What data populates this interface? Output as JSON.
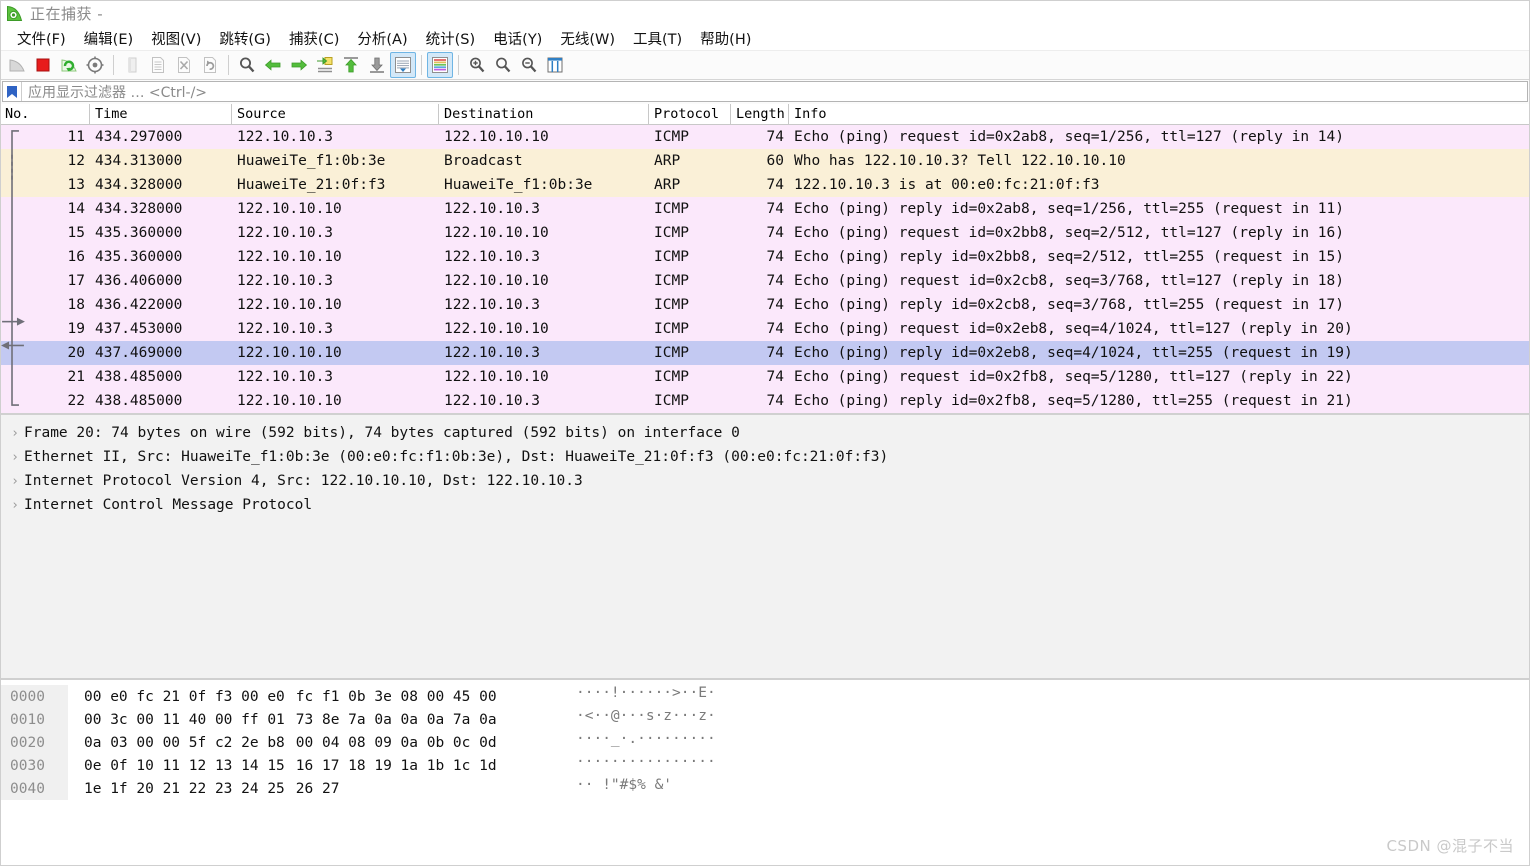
{
  "window": {
    "title": "正在捕获 -",
    "icon": "wireshark-fin-icon"
  },
  "menu": {
    "items": [
      {
        "label": "文件(F)",
        "name": "menu-file"
      },
      {
        "label": "编辑(E)",
        "name": "menu-edit"
      },
      {
        "label": "视图(V)",
        "name": "menu-view"
      },
      {
        "label": "跳转(G)",
        "name": "menu-go"
      },
      {
        "label": "捕获(C)",
        "name": "menu-capture"
      },
      {
        "label": "分析(A)",
        "name": "menu-analyze"
      },
      {
        "label": "统计(S)",
        "name": "menu-statistics"
      },
      {
        "label": "电话(Y)",
        "name": "menu-telephony"
      },
      {
        "label": "无线(W)",
        "name": "menu-wireless"
      },
      {
        "label": "工具(T)",
        "name": "menu-tools"
      },
      {
        "label": "帮助(H)",
        "name": "menu-help"
      }
    ]
  },
  "toolbar": {
    "buttons": [
      {
        "name": "start-capture-icon",
        "active": false
      },
      {
        "name": "stop-capture-icon",
        "active": false
      },
      {
        "name": "restart-capture-icon",
        "active": false
      },
      {
        "name": "capture-options-icon",
        "active": false
      },
      {
        "name": "open-file-icon",
        "active": false
      },
      {
        "name": "save-file-icon",
        "active": false
      },
      {
        "name": "close-file-icon",
        "active": false
      },
      {
        "name": "reload-file-icon",
        "active": false
      },
      {
        "name": "find-packet-icon",
        "active": false
      },
      {
        "name": "go-back-icon",
        "active": false
      },
      {
        "name": "go-forward-icon",
        "active": false
      },
      {
        "name": "go-to-packet-icon",
        "active": false
      },
      {
        "name": "go-first-packet-icon",
        "active": false
      },
      {
        "name": "go-last-packet-icon",
        "active": false
      },
      {
        "name": "auto-scroll-icon",
        "active": true
      },
      {
        "name": "colorize-packets-icon",
        "active": true
      },
      {
        "name": "zoom-in-icon",
        "active": false
      },
      {
        "name": "zoom-out-icon",
        "active": false
      },
      {
        "name": "zoom-reset-icon",
        "active": false
      },
      {
        "name": "resize-columns-icon",
        "active": false
      }
    ]
  },
  "filter": {
    "placeholder": "应用显示过滤器 … <Ctrl-/>",
    "value": "",
    "bookmark_icon": "bookmark-icon"
  },
  "packet_list": {
    "columns": [
      {
        "label": "No.",
        "name": "column-no"
      },
      {
        "label": "Time",
        "name": "column-time"
      },
      {
        "label": "Source",
        "name": "column-source"
      },
      {
        "label": "Destination",
        "name": "column-destination"
      },
      {
        "label": "Protocol",
        "name": "column-protocol"
      },
      {
        "label": "Length",
        "name": "column-length"
      },
      {
        "label": "Info",
        "name": "column-info"
      }
    ],
    "rows": [
      {
        "no": "11",
        "time": "434.297000",
        "src": "122.10.10.3",
        "dst": "122.10.10.10",
        "proto": "ICMP",
        "len": "74",
        "info": "Echo (ping) request  id=0x2ab8, seq=1/256, ttl=127 (reply in 14)",
        "style": "icmp",
        "selected": false
      },
      {
        "no": "12",
        "time": "434.313000",
        "src": "HuaweiTe_f1:0b:3e",
        "dst": "Broadcast",
        "proto": "ARP",
        "len": "60",
        "info": "Who has 122.10.10.3? Tell 122.10.10.10",
        "style": "arp",
        "selected": false
      },
      {
        "no": "13",
        "time": "434.328000",
        "src": "HuaweiTe_21:0f:f3",
        "dst": "HuaweiTe_f1:0b:3e",
        "proto": "ARP",
        "len": "74",
        "info": "122.10.10.3 is at 00:e0:fc:21:0f:f3",
        "style": "arp",
        "selected": false
      },
      {
        "no": "14",
        "time": "434.328000",
        "src": "122.10.10.10",
        "dst": "122.10.10.3",
        "proto": "ICMP",
        "len": "74",
        "info": "Echo (ping) reply    id=0x2ab8, seq=1/256, ttl=255 (request in 11)",
        "style": "icmp",
        "selected": false
      },
      {
        "no": "15",
        "time": "435.360000",
        "src": "122.10.10.3",
        "dst": "122.10.10.10",
        "proto": "ICMP",
        "len": "74",
        "info": "Echo (ping) request  id=0x2bb8, seq=2/512, ttl=127 (reply in 16)",
        "style": "icmp",
        "selected": false
      },
      {
        "no": "16",
        "time": "435.360000",
        "src": "122.10.10.10",
        "dst": "122.10.10.3",
        "proto": "ICMP",
        "len": "74",
        "info": "Echo (ping) reply    id=0x2bb8, seq=2/512, ttl=255 (request in 15)",
        "style": "icmp",
        "selected": false
      },
      {
        "no": "17",
        "time": "436.406000",
        "src": "122.10.10.3",
        "dst": "122.10.10.10",
        "proto": "ICMP",
        "len": "74",
        "info": "Echo (ping) request  id=0x2cb8, seq=3/768, ttl=127 (reply in 18)",
        "style": "icmp",
        "selected": false
      },
      {
        "no": "18",
        "time": "436.422000",
        "src": "122.10.10.10",
        "dst": "122.10.10.3",
        "proto": "ICMP",
        "len": "74",
        "info": "Echo (ping) reply    id=0x2cb8, seq=3/768, ttl=255 (request in 17)",
        "style": "icmp",
        "selected": false
      },
      {
        "no": "19",
        "time": "437.453000",
        "src": "122.10.10.3",
        "dst": "122.10.10.10",
        "proto": "ICMP",
        "len": "74",
        "info": "Echo (ping) request  id=0x2eb8, seq=4/1024, ttl=127 (reply in 20)",
        "style": "icmp",
        "selected": false
      },
      {
        "no": "20",
        "time": "437.469000",
        "src": "122.10.10.10",
        "dst": "122.10.10.3",
        "proto": "ICMP",
        "len": "74",
        "info": "Echo (ping) reply    id=0x2eb8, seq=4/1024, ttl=255 (request in 19)",
        "style": "icmp",
        "selected": true
      },
      {
        "no": "21",
        "time": "438.485000",
        "src": "122.10.10.3",
        "dst": "122.10.10.10",
        "proto": "ICMP",
        "len": "74",
        "info": "Echo (ping) request  id=0x2fb8, seq=5/1280, ttl=127 (reply in 22)",
        "style": "icmp",
        "selected": false
      },
      {
        "no": "22",
        "time": "438.485000",
        "src": "122.10.10.10",
        "dst": "122.10.10.3",
        "proto": "ICMP",
        "len": "74",
        "info": "Echo (ping) reply    id=0x2fb8, seq=5/1280, ttl=255 (request in 21)",
        "style": "icmp",
        "selected": false
      }
    ]
  },
  "packet_detail": {
    "rows": [
      {
        "text": "Frame 20: 74 bytes on wire (592 bits), 74 bytes captured (592 bits) on interface 0",
        "name": "detail-frame"
      },
      {
        "text": "Ethernet II, Src: HuaweiTe_f1:0b:3e (00:e0:fc:f1:0b:3e), Dst: HuaweiTe_21:0f:f3 (00:e0:fc:21:0f:f3)",
        "name": "detail-ethernet"
      },
      {
        "text": "Internet Protocol Version 4, Src: 122.10.10.10, Dst: 122.10.10.3",
        "name": "detail-ipv4"
      },
      {
        "text": "Internet Control Message Protocol",
        "name": "detail-icmp"
      }
    ]
  },
  "hex_dump": {
    "rows": [
      {
        "offset": "0000",
        "left": "00 e0 fc 21 0f f3 00 e0",
        "right": "fc f1 0b 3e 08 00 45 00",
        "ascii_left": "····!···",
        "ascii_right": "···>··E·"
      },
      {
        "offset": "0010",
        "left": "00 3c 00 11 40 00 ff 01",
        "right": "73 8e 7a 0a 0a 0a 7a 0a",
        "ascii_left": "·<··@···",
        "ascii_right": "s·z···z·"
      },
      {
        "offset": "0020",
        "left": "0a 03 00 00 5f c2 2e b8",
        "right": "00 04 08 09 0a 0b 0c 0d",
        "ascii_left": "····_·.·",
        "ascii_right": "········"
      },
      {
        "offset": "0030",
        "left": "0e 0f 10 11 12 13 14 15",
        "right": "16 17 18 19 1a 1b 1c 1d",
        "ascii_left": "········",
        "ascii_right": "········"
      },
      {
        "offset": "0040",
        "left": "1e 1f 20 21 22 23 24 25",
        "right": "26 27",
        "ascii_left": "·· !\"#$%",
        "ascii_right": " &'"
      }
    ]
  },
  "watermark": {
    "text": "CSDN @混子不当"
  },
  "colors": {
    "icmp_row": "#fbe8fb",
    "arp_row": "#faf0d7",
    "selected_row": "#c3c9f2",
    "detail_bg": "#f2f2f2",
    "accent": "#6fb5e4"
  }
}
